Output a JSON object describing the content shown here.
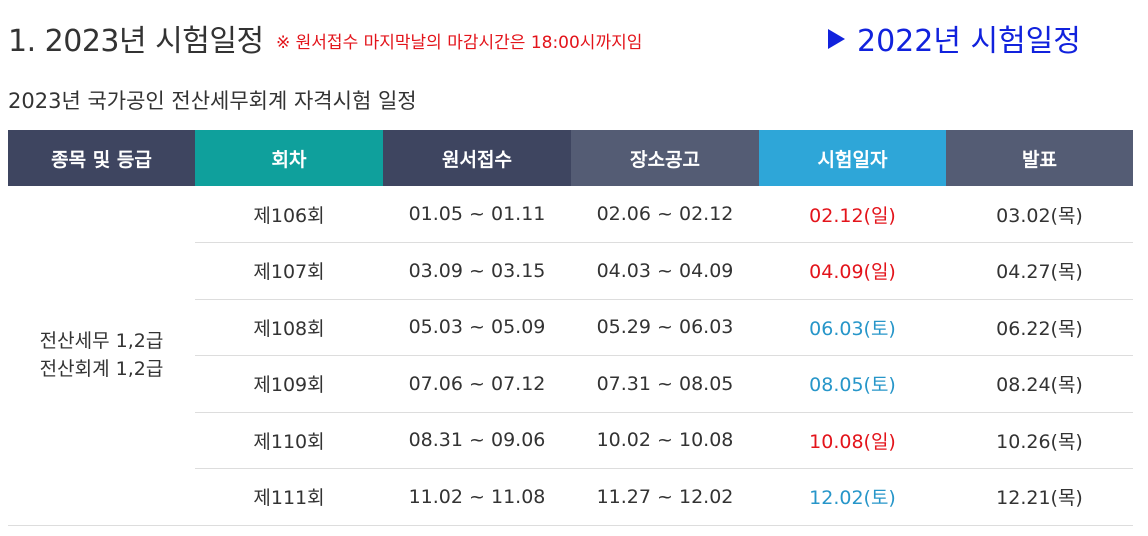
{
  "header": {
    "title": "1. 2023년 시험일정",
    "deadline_note": "※ 원서접수 마지막날의 마감시간은 18:00시까지임",
    "prev_year_link": "2022년 시험일정"
  },
  "subtitle": "2023년 국가공인 전산세무회계 자격시험 일정",
  "table": {
    "columns": [
      "종목 및 등급",
      "회차",
      "원서접수",
      "장소공고",
      "시험일자",
      "발표"
    ],
    "grade_lines": [
      "전산세무 1,2급",
      "전산회계 1,2급"
    ],
    "rows": [
      {
        "round": "제106회",
        "apply": "01.05 ~ 01.11",
        "place": "02.06 ~ 02.12",
        "exam": "02.12(일)",
        "result": "03.02(목)"
      },
      {
        "round": "제107회",
        "apply": "03.09 ~ 03.15",
        "place": "04.03 ~ 04.09",
        "exam": "04.09(일)",
        "result": "04.27(목)"
      },
      {
        "round": "제108회",
        "apply": "05.03 ~ 05.09",
        "place": "05.29 ~ 06.03",
        "exam": "06.03(토)",
        "result": "06.22(목)"
      },
      {
        "round": "제109회",
        "apply": "07.06 ~ 07.12",
        "place": "07.31 ~ 08.05",
        "exam": "08.05(토)",
        "result": "08.24(목)"
      },
      {
        "round": "제110회",
        "apply": "08.31 ~ 09.06",
        "place": "10.02 ~ 10.08",
        "exam": "10.08(일)",
        "result": "10.26(목)"
      },
      {
        "round": "제111회",
        "apply": "11.02 ~ 11.08",
        "place": "11.27 ~ 12.02",
        "exam": "12.02(토)",
        "result": "12.21(목)"
      }
    ]
  },
  "colors": {
    "header_dark": "#3e4560",
    "header_teal": "#0fa09c",
    "header_slate": "#545c74",
    "header_blue": "#2ea6d8",
    "round_text": "#1a9b95",
    "sunday_red": "#e3141b",
    "saturday_blue": "#2796c9",
    "link_blue": "#1122dd"
  }
}
